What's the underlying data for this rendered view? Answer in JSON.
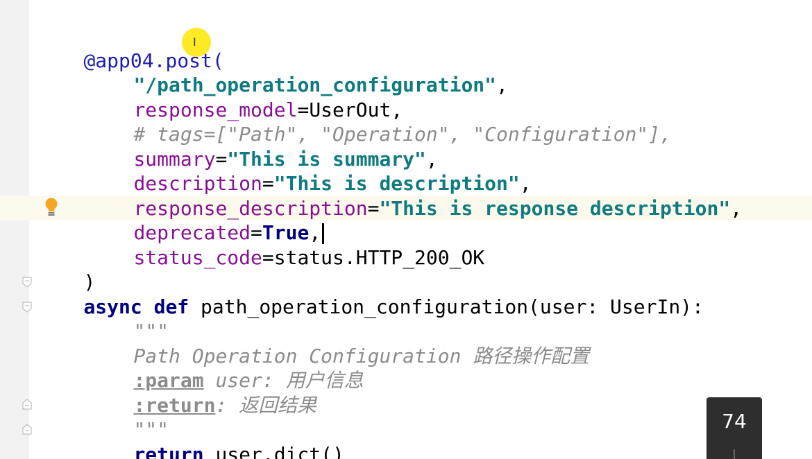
{
  "editor": {
    "lines": [
      {
        "decorator": "@app04.post(",
        "open": ""
      },
      {
        "string": "\"/path_operation_configuration\"",
        "after": ","
      },
      {
        "param": "response_model",
        "eq": "=",
        "value": "UserOut",
        "after": ","
      },
      {
        "comment": "# tags=[\"Path\", \"Operation\", \"Configuration\"],"
      },
      {
        "param": "summary",
        "eq": "=",
        "string": "\"This is summary\"",
        "after": ","
      },
      {
        "param": "description",
        "eq": "=",
        "string": "\"This is description\"",
        "after": ","
      },
      {
        "param": "response_description",
        "eq": "=",
        "string": "\"This is response description\"",
        "after": ","
      },
      {
        "param": "deprecated",
        "eq": "=",
        "value": "True",
        "after": ","
      },
      {
        "param": "status_code",
        "eq": "=",
        "value": "status.HTTP_200_OK"
      },
      {
        "text": ")"
      },
      {
        "kw1": "async",
        "kw2": "def",
        "rest": " path_operation_configuration(user: UserIn):"
      },
      {
        "doc": "\"\"\""
      },
      {
        "doc": "Path Operation Configuration 路径操作配置"
      },
      {
        "tag": ":param",
        "doc": " user: 用户信息"
      },
      {
        "tag": ":return",
        "doc": ": 返回结果"
      },
      {
        "doc": "\"\"\""
      },
      {
        "kw": "return",
        "rest": " user.dict()"
      }
    ]
  },
  "badge": {
    "value": "74"
  },
  "colors": {
    "current_line": "#fcfaed",
    "gutter": "#f2f2f2",
    "badge_bg": "#2e2e2e",
    "mouse_highlight": "#ffe600"
  }
}
